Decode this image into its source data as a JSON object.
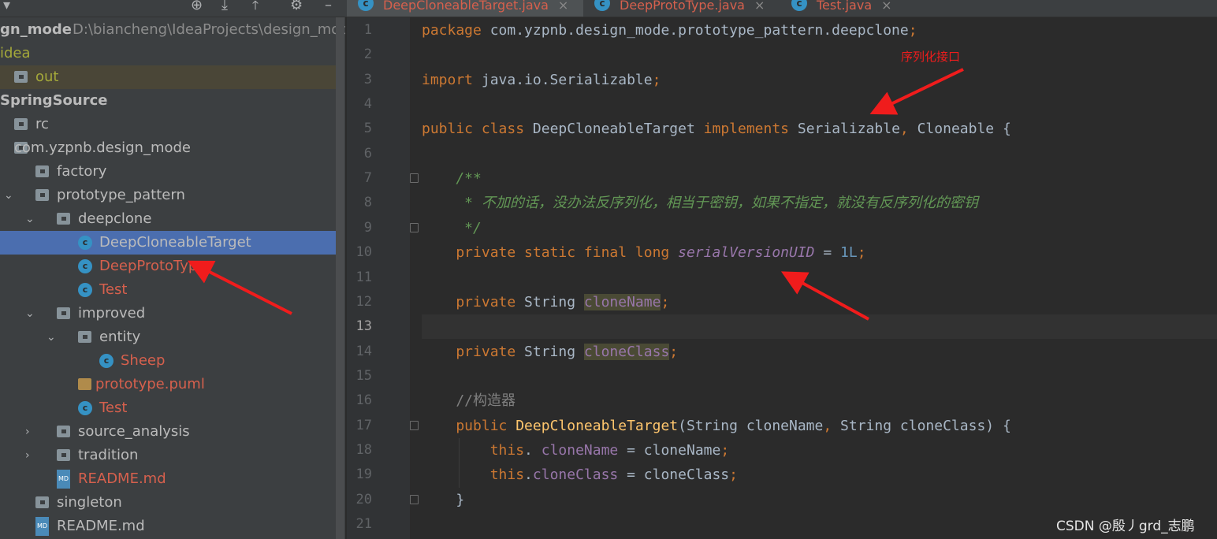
{
  "sidebar": {
    "toolbar_icons": [
      "dropdown-icon",
      "locate-icon",
      "expand-all-icon",
      "collapse-all-icon",
      "gear-icon",
      "minimize-icon"
    ],
    "tree": [
      {
        "label": "gn_mode",
        "extra": "D:\\biancheng\\IdeaProjects\\design_mode",
        "bold": true,
        "level": 0,
        "type": "module"
      },
      {
        "label": "idea",
        "level": 0,
        "type": "folder",
        "color": "olive"
      },
      {
        "label": "out",
        "level": 0,
        "type": "folder",
        "color": "olive",
        "excluded": true
      },
      {
        "label": "SpringSource",
        "level": 0,
        "type": "module",
        "bold": true
      },
      {
        "label": "rc",
        "level": 0,
        "type": "folder"
      },
      {
        "label": "com.yzpnb.design_mode",
        "level": 0,
        "type": "package",
        "expanded": true
      },
      {
        "label": "factory",
        "level": 1,
        "type": "package"
      },
      {
        "label": "prototype_pattern",
        "level": 1,
        "type": "package",
        "expanded": true
      },
      {
        "label": "deepclone",
        "level": 2,
        "type": "package",
        "expanded": true
      },
      {
        "label": "DeepCloneableTarget",
        "level": 3,
        "type": "class",
        "selected": true
      },
      {
        "label": "DeepProtoType",
        "level": 3,
        "type": "class",
        "color": "red"
      },
      {
        "label": "Test",
        "level": 3,
        "type": "class",
        "color": "red"
      },
      {
        "label": "improved",
        "level": 2,
        "type": "package",
        "expanded": true
      },
      {
        "label": "entity",
        "level": 3,
        "type": "package",
        "expanded": true
      },
      {
        "label": "Sheep",
        "level": 4,
        "type": "class",
        "color": "red"
      },
      {
        "label": "prototype.puml",
        "level": 3,
        "type": "puml",
        "color": "red"
      },
      {
        "label": "Test",
        "level": 3,
        "type": "class",
        "color": "red"
      },
      {
        "label": "source_analysis",
        "level": 2,
        "type": "package",
        "collapsed": true
      },
      {
        "label": "tradition",
        "level": 2,
        "type": "package",
        "collapsed": true
      },
      {
        "label": "README.md",
        "level": 2,
        "type": "md",
        "color": "red"
      },
      {
        "label": "singleton",
        "level": 1,
        "type": "package"
      },
      {
        "label": "README.md",
        "level": 1,
        "type": "md"
      }
    ]
  },
  "tabs": [
    {
      "label": "DeepCloneableTarget.java",
      "active": true
    },
    {
      "label": "DeepProtoType.java"
    },
    {
      "label": "Test.java"
    }
  ],
  "editor": {
    "current_line": 13,
    "lines": [
      [
        [
          "kw",
          "package "
        ],
        [
          "",
          "com.yzpnb.design_mode.prototype_pattern.deepclone"
        ],
        [
          "kw",
          ";"
        ]
      ],
      [],
      [
        [
          "kw",
          "import "
        ],
        [
          "",
          "java.io.Serializable"
        ],
        [
          "kw",
          ";"
        ]
      ],
      [],
      [
        [
          "kw",
          "public class "
        ],
        [
          "",
          "DeepCloneableTarget "
        ],
        [
          "kw",
          "implements "
        ],
        [
          "",
          "Serializable"
        ],
        [
          "kw",
          ", "
        ],
        [
          "",
          "Cloneable {"
        ]
      ],
      [],
      [
        [
          "cm",
          "    /**"
        ]
      ],
      [
        [
          "cm",
          "     * 不加的话，没办法反序列化，相当于密钥，如果不指定，就没有反序列化的密钥"
        ]
      ],
      [
        [
          "cm",
          "     */"
        ]
      ],
      [
        [
          "kw",
          "    private static final long "
        ],
        [
          "sfld",
          "serialVersionUID"
        ],
        [
          "",
          " = "
        ],
        [
          "num",
          "1L"
        ],
        [
          "kw",
          ";"
        ]
      ],
      [],
      [
        [
          "kw",
          "    private "
        ],
        [
          "",
          "String "
        ],
        [
          "fld hl",
          "cloneName"
        ],
        [
          "kw",
          ";"
        ]
      ],
      [],
      [
        [
          "kw",
          "    private "
        ],
        [
          "",
          "String "
        ],
        [
          "fld hl",
          "cloneClass"
        ],
        [
          "kw",
          ";"
        ]
      ],
      [],
      [
        [
          "lc",
          "    //构造器"
        ]
      ],
      [
        [
          "kw",
          "    public "
        ],
        [
          "fn",
          "DeepCloneableTarget"
        ],
        [
          "",
          "(String cloneName"
        ],
        [
          "kw",
          ", "
        ],
        [
          "",
          "String cloneClass) {"
        ]
      ],
      [
        [
          "kw",
          "        this"
        ],
        [
          "",
          ". "
        ],
        [
          "fld",
          "cloneName"
        ],
        [
          "",
          " = cloneName"
        ],
        [
          "kw",
          ";"
        ]
      ],
      [
        [
          "kw",
          "        this"
        ],
        [
          "",
          "."
        ],
        [
          "fld",
          "cloneClass"
        ],
        [
          "",
          " = cloneClass"
        ],
        [
          "kw",
          ";"
        ]
      ],
      [
        [
          "",
          "    }"
        ]
      ],
      []
    ]
  },
  "annotation": "序列化接口",
  "watermark": "CSDN @殷丿grd_志鹏",
  "colors": {
    "annotation_arrow": "#f01c1c",
    "selection": "#4b6eaf",
    "keyword": "#cc7832"
  }
}
